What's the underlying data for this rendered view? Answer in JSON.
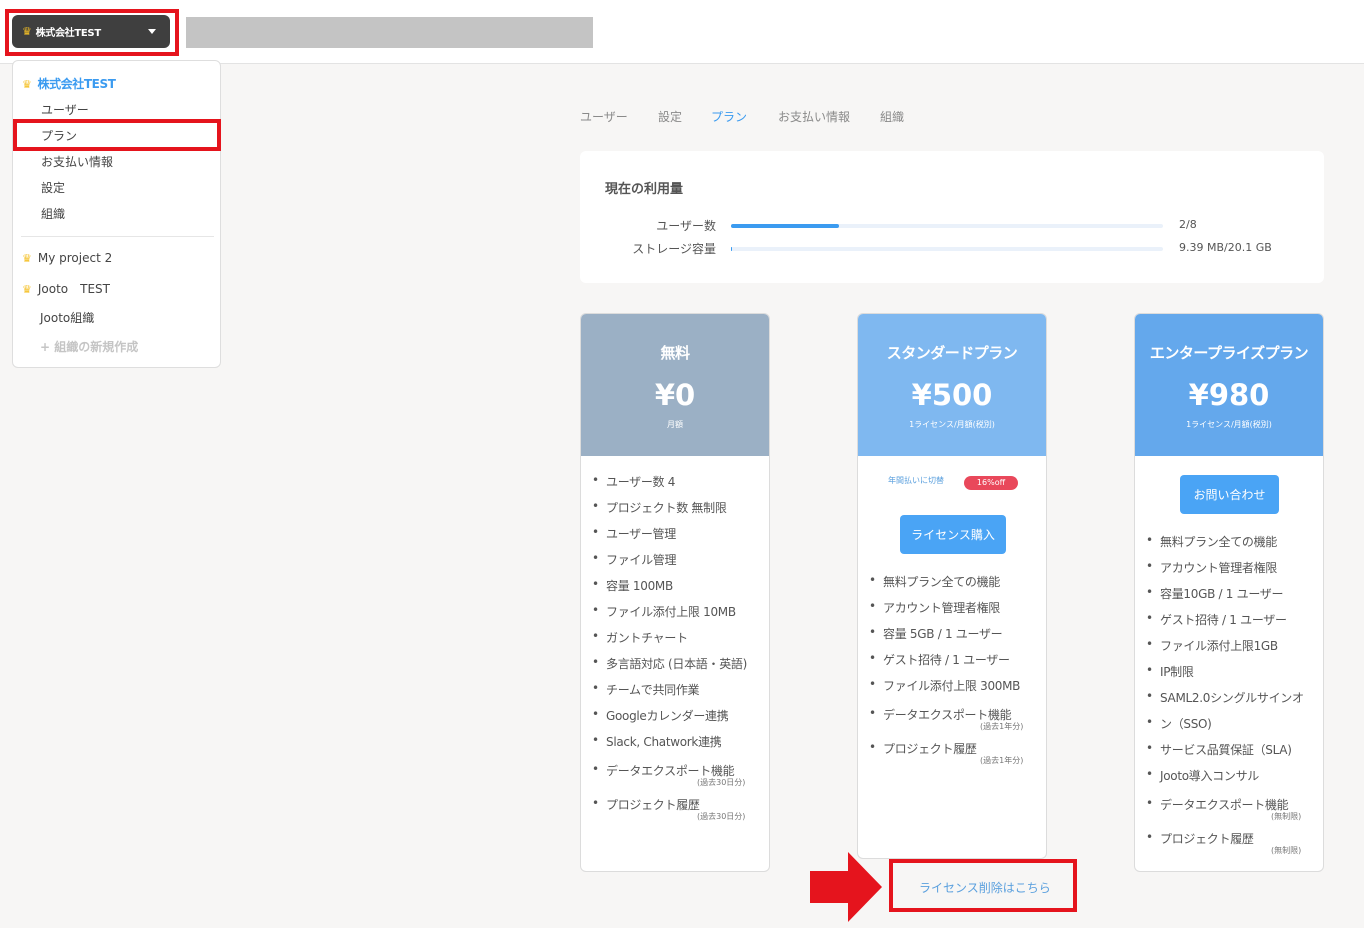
{
  "header": {
    "org_name": "株式会社TEST"
  },
  "dropdown": {
    "current_org": "株式会社TEST",
    "menu": [
      "ユーザー",
      "プラン",
      "お支払い情報",
      "設定",
      "組織"
    ],
    "orgs": [
      "My project 2",
      "Jooto　TEST",
      "Jooto組織"
    ],
    "new_org": "+ 組織の新規作成"
  },
  "tabs": [
    "ユーザー",
    "設定",
    "プラン",
    "お支払い情報",
    "組織"
  ],
  "active_tab": "プラン",
  "usage": {
    "title": "現在の利用量",
    "users_label": "ユーザー数",
    "users_value": "2/8",
    "users_fraction": 0.25,
    "storage_label": "ストレージ容量",
    "storage_value": "9.39 MB/20.1 GB",
    "storage_fraction": 0.0005
  },
  "plans": {
    "free": {
      "name": "無料",
      "price": "¥0",
      "note": "月額",
      "features": [
        "ユーザー数 4",
        "プロジェクト数 無制限",
        "ユーザー管理",
        "ファイル管理",
        "容量 100MB",
        "ファイル添付上限 10MB",
        "ガントチャート",
        "多言語対応 (日本語・英語)",
        "チームで共同作業",
        "Googleカレンダー連携",
        "Slack, Chatwork連携",
        "データエクスポート機能",
        "プロジェクト履歴"
      ],
      "sub1": "(過去30日分)",
      "sub2": "(過去30日分)"
    },
    "standard": {
      "name": "スタンダードプラン",
      "price": "¥500",
      "note": "1ライセンス/月額(税別)",
      "annual": "年間払いに切替",
      "badge": "16%off",
      "button": "ライセンス購入",
      "features": [
        "無料プラン全ての機能",
        "アカウント管理者権限",
        "容量 5GB / 1 ユーザー",
        "ゲスト招待 / 1 ユーザー",
        "ファイル添付上限 300MB",
        "データエクスポート機能",
        "プロジェクト履歴"
      ],
      "sub1": "(過去1年分)",
      "sub2": "(過去1年分)"
    },
    "enterprise": {
      "name": "エンタープライズプラン",
      "price": "¥980",
      "note": "1ライセンス/月額(税別)",
      "button": "お問い合わせ",
      "features": [
        "無料プラン全ての機能",
        "アカウント管理者権限",
        "容量10GB / 1 ユーザー",
        "ゲスト招待 / 1 ユーザー",
        "ファイル添付上限1GB",
        "IP制限",
        "SAML2.0シングルサインオ",
        "ン（SSO)",
        "サービス品質保証（SLA)",
        "Jooto導入コンサル",
        "データエクスポート機能",
        "プロジェクト履歴"
      ],
      "sub1": "(無制限)",
      "sub2": "(無制限)"
    }
  },
  "delete_link": "ライセンス削除はこちら",
  "colors": {
    "accent": "#3b9bf0",
    "free_header": "#9bb0c5",
    "standard_header": "#7fb8f0",
    "enterprise_header": "#64a8ec",
    "highlight": "#e5141d"
  }
}
